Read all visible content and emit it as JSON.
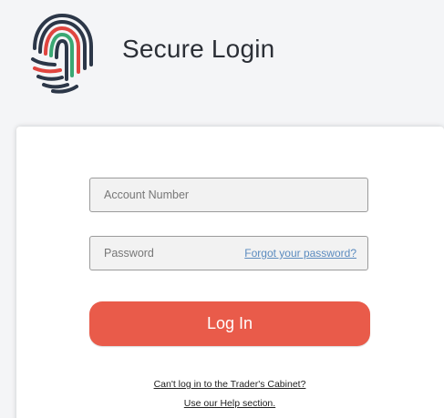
{
  "header": {
    "title": "Secure Login",
    "logo_icon": "fingerprint-icon"
  },
  "form": {
    "account_placeholder": "Account Number",
    "account_value": "",
    "password_placeholder": "Password",
    "password_value": "",
    "forgot_label": "Forgot your password?",
    "login_label": "Log In"
  },
  "links": {
    "cant_login": "Can't log in to the Trader's Cabinet?",
    "help": "Use our Help section."
  },
  "colors": {
    "accent": "#e95b4a",
    "link": "#5b8bbf",
    "background": "#f4f5f7",
    "logo_dark": "#2c3748",
    "logo_red": "#e0453f",
    "logo_green": "#3aa873"
  }
}
